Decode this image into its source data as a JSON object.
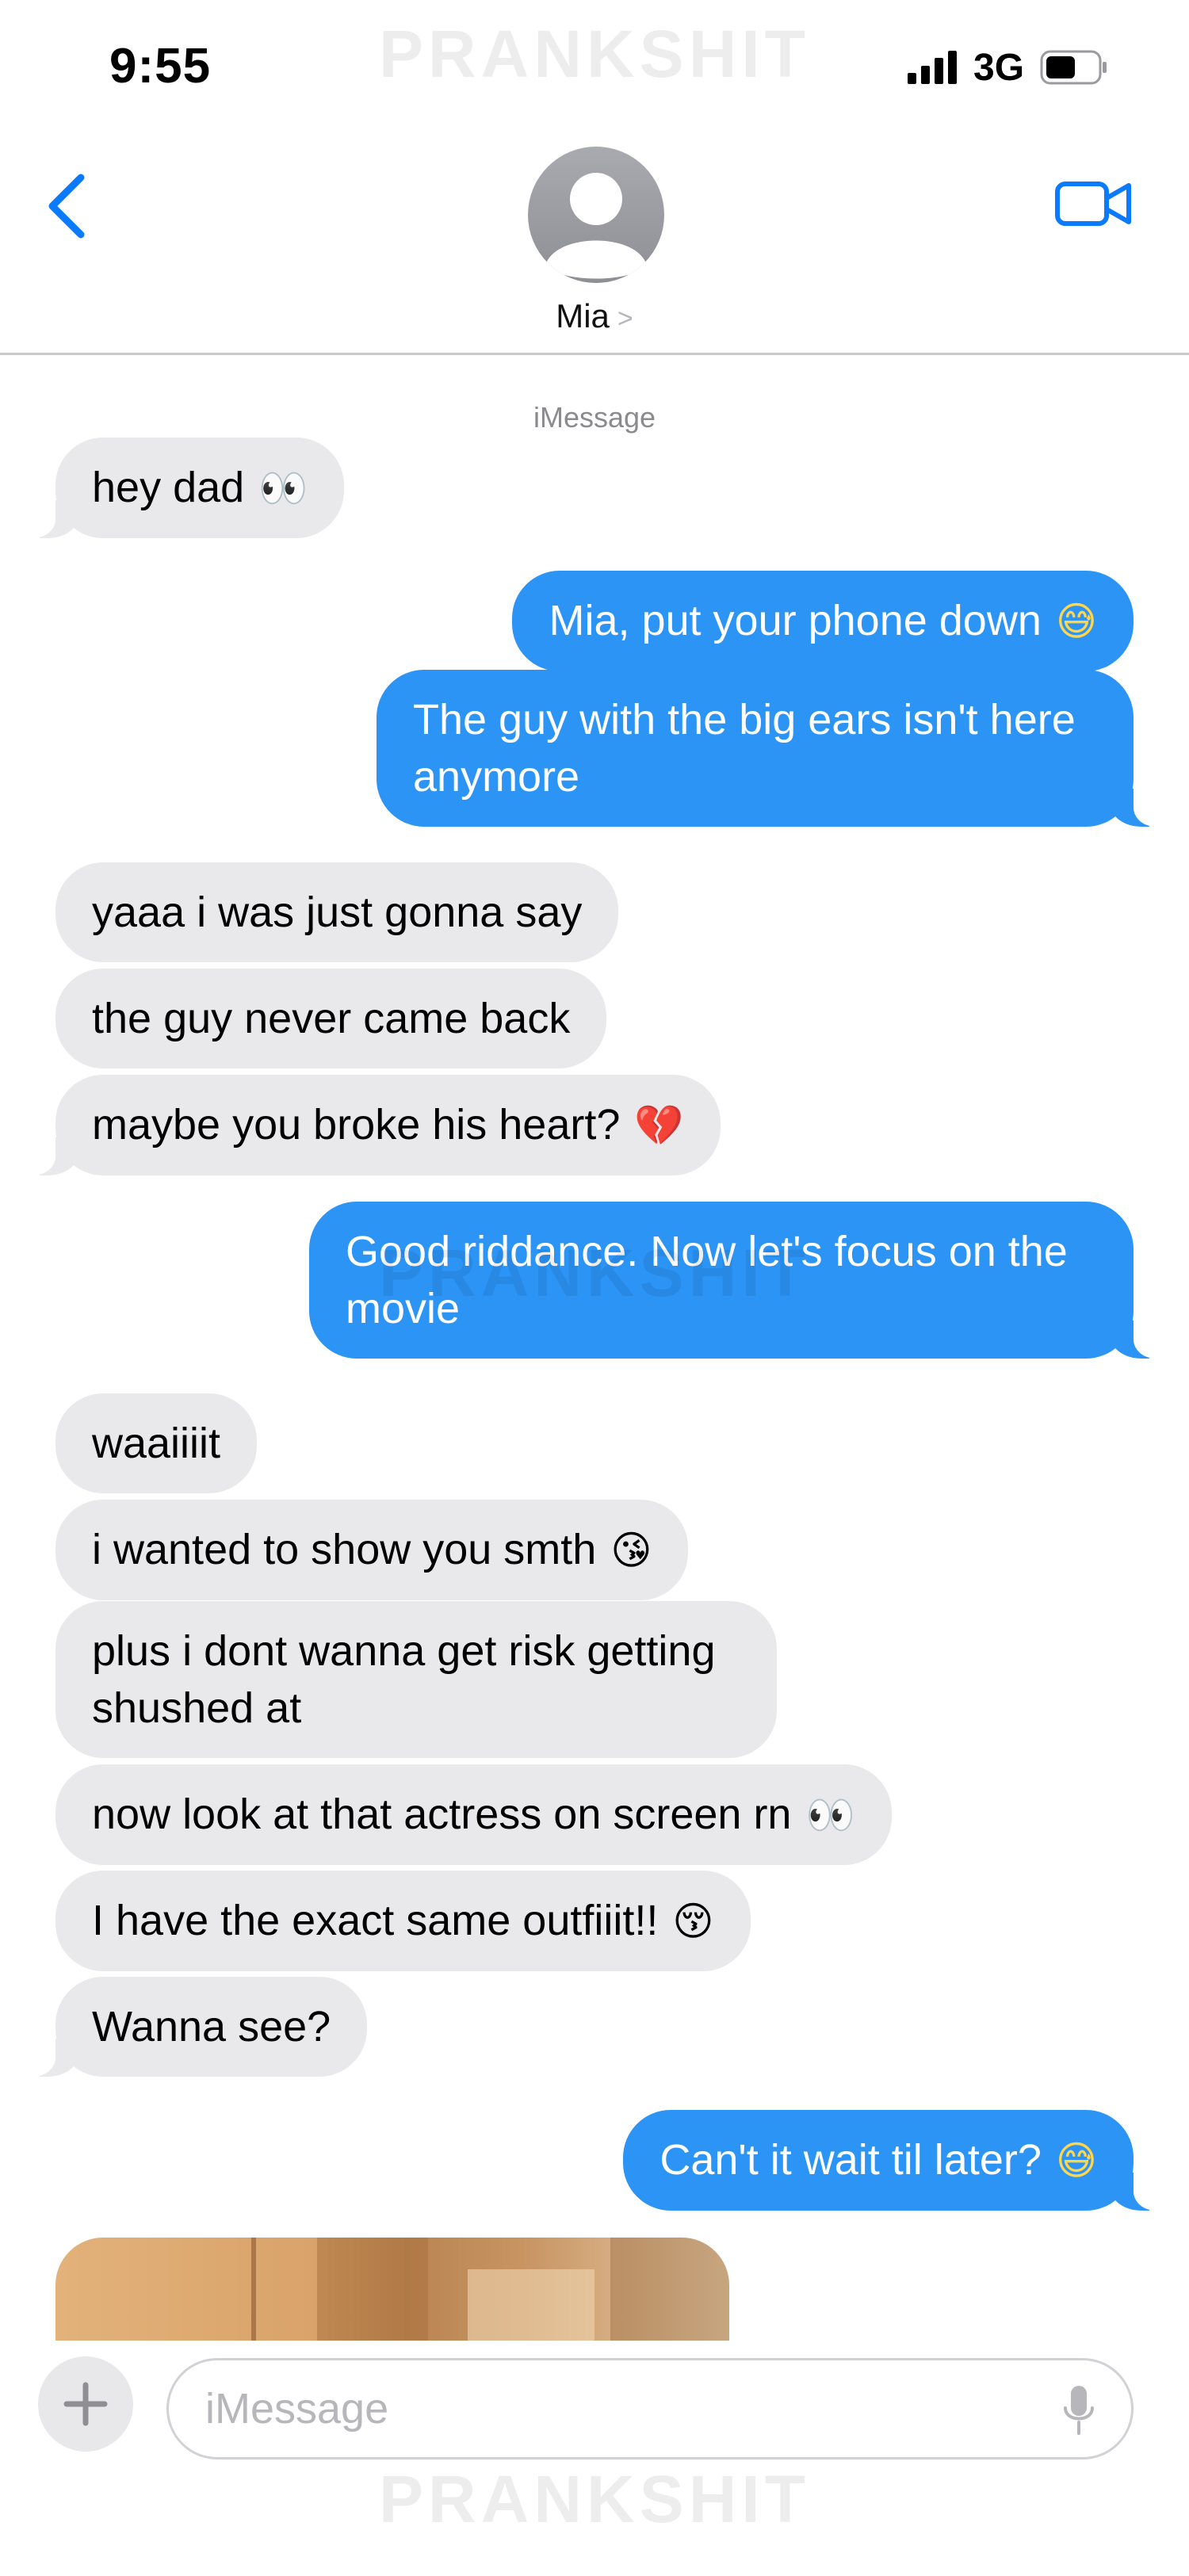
{
  "status_bar": {
    "time": "9:55",
    "network": "3G",
    "watermark": "PRANKSHIT",
    "signal_icon": "cellular-signal-icon",
    "battery_icon": "battery-icon"
  },
  "header": {
    "back_icon": "chevron-left-icon",
    "avatar_icon": "person-icon",
    "contact_name": "Mia",
    "detail_chevron": ">",
    "video_icon": "video-camera-icon"
  },
  "conversation": {
    "service_label": "iMessage",
    "messages": [
      {
        "from": "contact",
        "text": "hey dad",
        "emoji": "eyes"
      },
      {
        "from": "me",
        "text": "Mia, put your phone down",
        "emoji": "grinning-sweat"
      },
      {
        "from": "me",
        "text": "The guy with the big ears isn't here anymore"
      },
      {
        "from": "contact",
        "text": "yaaa i was just gonna say"
      },
      {
        "from": "contact",
        "text": "the guy never came back"
      },
      {
        "from": "contact",
        "text": "maybe you broke his heart?",
        "emoji": "broken-heart"
      },
      {
        "from": "me",
        "text": "Good riddance. Now let's focus on the movie"
      },
      {
        "from": "contact",
        "text": "waaiiiit"
      },
      {
        "from": "contact",
        "text": "i wanted to show you smth",
        "emoji": "face-blowing-kiss"
      },
      {
        "from": "contact",
        "text": "plus i dont wanna get risk getting shushed at"
      },
      {
        "from": "contact",
        "text": "now look at that actress on screen rn",
        "emoji": "eyes"
      },
      {
        "from": "contact",
        "text": "I have the exact same outfiiit!!",
        "emoji": "kissing-face"
      },
      {
        "from": "contact",
        "text": "Wanna see?"
      },
      {
        "from": "me",
        "text": "Can't it wait til later?",
        "emoji": "grinning-sweat"
      }
    ],
    "attachment_icon": "photo-attachment"
  },
  "compose": {
    "placeholder": "iMessage",
    "value": "",
    "apps_icon": "plus-icon",
    "mic_icon": "microphone-icon"
  },
  "colors": {
    "outgoing_bubble": "#2b94f5",
    "incoming_bubble": "#e9e9eb",
    "accent": "#0a7aff"
  }
}
